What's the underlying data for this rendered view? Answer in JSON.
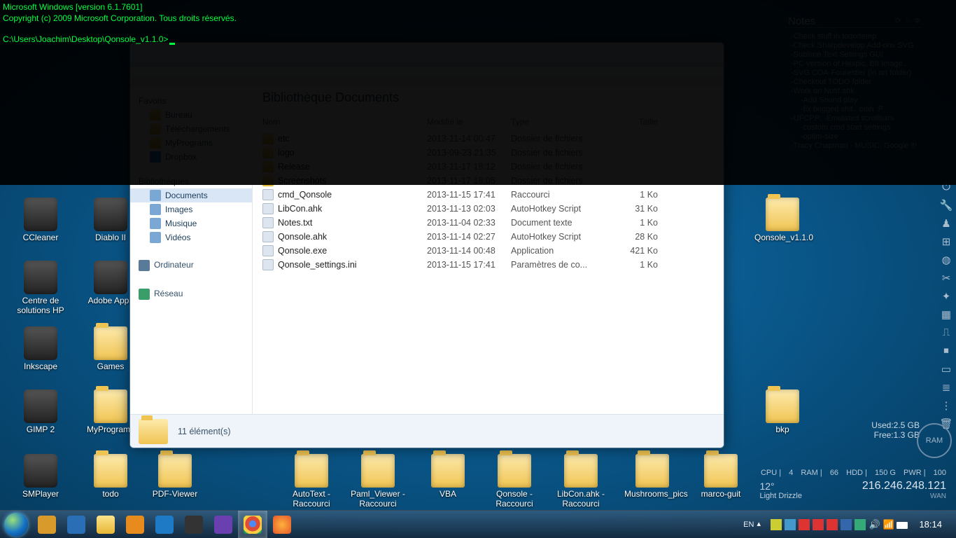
{
  "console": {
    "line1": "Microsoft Windows [version 6.1.7601]",
    "line2": "Copyright (c) 2009 Microsoft Corporation. Tous droits réservés.",
    "prompt": "C:\\Users\\Joachim\\Desktop\\Qonsole_v1.1.0>"
  },
  "desktop_icons_left": [
    {
      "label": "CCleaner",
      "t": 282,
      "l": 18,
      "cls": "app"
    },
    {
      "label": "Diablo II",
      "t": 282,
      "l": 118,
      "cls": "app"
    },
    {
      "label": "Centre de solutions HP",
      "t": 372,
      "l": 18,
      "cls": "app"
    },
    {
      "label": "Adobe Apps",
      "t": 372,
      "l": 118,
      "cls": "app"
    },
    {
      "label": "Inkscape",
      "t": 466,
      "l": 18,
      "cls": "app"
    },
    {
      "label": "Games",
      "t": 466,
      "l": 118,
      "cls": "folder"
    },
    {
      "label": "GIMP 2",
      "t": 556,
      "l": 18,
      "cls": "app"
    },
    {
      "label": "MyPrograms",
      "t": 556,
      "l": 118,
      "cls": "folder"
    },
    {
      "label": "SMPlayer",
      "t": 648,
      "l": 18,
      "cls": "app"
    },
    {
      "label": "todo",
      "t": 648,
      "l": 118,
      "cls": "folder"
    }
  ],
  "desktop_icons_bottom": [
    {
      "label": "PDF-Viewer",
      "l": 210
    },
    {
      "label": "AutoText - Raccourci",
      "l": 405
    },
    {
      "label": "Paml_Viewer - Raccourci",
      "l": 500
    },
    {
      "label": "VBA",
      "l": 600
    },
    {
      "label": "Qonsole - Raccourci",
      "l": 695
    },
    {
      "label": "LibCon.ahk - Raccourci",
      "l": 790
    },
    {
      "label": "Mushrooms_pics",
      "l": 892
    },
    {
      "label": "marco-guit",
      "l": 990
    }
  ],
  "desktop_icons_right": [
    {
      "label": "Qonsole_v1.1.0",
      "t": 282,
      "cls": "folder"
    },
    {
      "label": "bkp",
      "t": 556,
      "cls": "folder"
    }
  ],
  "notes": {
    "title": "Notes",
    "lines": [
      {
        "t": "-Check stuff in todo/temp"
      },
      {
        "t": "-Check Sharpdevelop Add-ons SVG"
      },
      {
        "t": "-Sublime Text Settings GUI"
      },
      {
        "t": "-PC version of Hexpic, BII Image.."
      },
      {
        "t": "-SVG COA-Fourestier (in art folder)"
      },
      {
        "t": "-Checkout TODO folder"
      },
      {
        "t": "-Work on Notif.ahk"
      },
      {
        "t": "-Add Sound play",
        "ind": true
      },
      {
        "t": "-fix bugged shit...blah :P",
        "ind": true
      },
      {
        "t": "-UFCPP:  -Emulated scrollbars"
      },
      {
        "t": "-custom cmd start settings",
        "ind": true
      },
      {
        "t": "-optim-size",
        "ind": true
      },
      {
        "t": "-Tracy Chapman - MUSIC, Google it!"
      }
    ]
  },
  "explorer": {
    "library_title": "Bibliothèque Documents",
    "nav": {
      "favoris": "Favoris",
      "bureau": "Bureau",
      "telech": "Téléchargements",
      "recents": "MyPrograms",
      "biblio": "Bibliothèques",
      "docs": "Documents",
      "images": "Images",
      "musique": "Musique",
      "videos": "Vidéos",
      "dropbox": "Dropbox",
      "ordi": "Ordinateur",
      "reseau": "Réseau"
    },
    "cols": {
      "name": "Nom",
      "date": "Modifié le",
      "type": "Type",
      "size": "Taille"
    },
    "files": [
      {
        "name": "etc",
        "date": "2013-11-14 00:47",
        "type": "Dossier de fichiers",
        "size": "",
        "folder": true
      },
      {
        "name": "logo",
        "date": "2013-09-23 21:35",
        "type": "Dossier de fichiers",
        "size": "",
        "folder": true
      },
      {
        "name": "Release",
        "date": "2013-11-17 18:12",
        "type": "Dossier de fichiers",
        "size": "",
        "folder": true
      },
      {
        "name": "Screenshots",
        "date": "2013-11-17 18:05",
        "type": "Dossier de fichiers",
        "size": "",
        "folder": true
      },
      {
        "name": "cmd_Qonsole",
        "date": "2013-11-15 17:41",
        "type": "Raccourci",
        "size": "1 Ko",
        "folder": false
      },
      {
        "name": "LibCon.ahk",
        "date": "2013-11-13 02:03",
        "type": "AutoHotkey Script",
        "size": "31 Ko",
        "folder": false
      },
      {
        "name": "Notes.txt",
        "date": "2013-11-04 02:33",
        "type": "Document texte",
        "size": "1 Ko",
        "folder": false
      },
      {
        "name": "Qonsole.ahk",
        "date": "2013-11-14 02:27",
        "type": "AutoHotkey Script",
        "size": "28 Ko",
        "folder": false
      },
      {
        "name": "Qonsole.exe",
        "date": "2013-11-14 00:48",
        "type": "Application",
        "size": "421 Ko",
        "folder": false
      },
      {
        "name": "Qonsole_settings.ini",
        "date": "2013-11-15 17:41",
        "type": "Paramètres de co...",
        "size": "1 Ko",
        "folder": false
      }
    ],
    "status": "11 élément(s)"
  },
  "ram": {
    "used": "Used:2.5 GB",
    "free": "Free:1.3 GB",
    "label": "RAM"
  },
  "stats": {
    "cpu": "CPU",
    "cpu_v": "4",
    "ram": "RAM",
    "ram_v": "66",
    "hdd": "HDD",
    "hdd_v": "150 G",
    "pwr": "PWR",
    "pwr_v": "100",
    "ip": "216.246.248.121",
    "wan": "WAN"
  },
  "weather": {
    "temp": "12°",
    "cond": "Light Drizzle"
  },
  "taskbar": {
    "lang": "EN",
    "clock": "18:14"
  }
}
